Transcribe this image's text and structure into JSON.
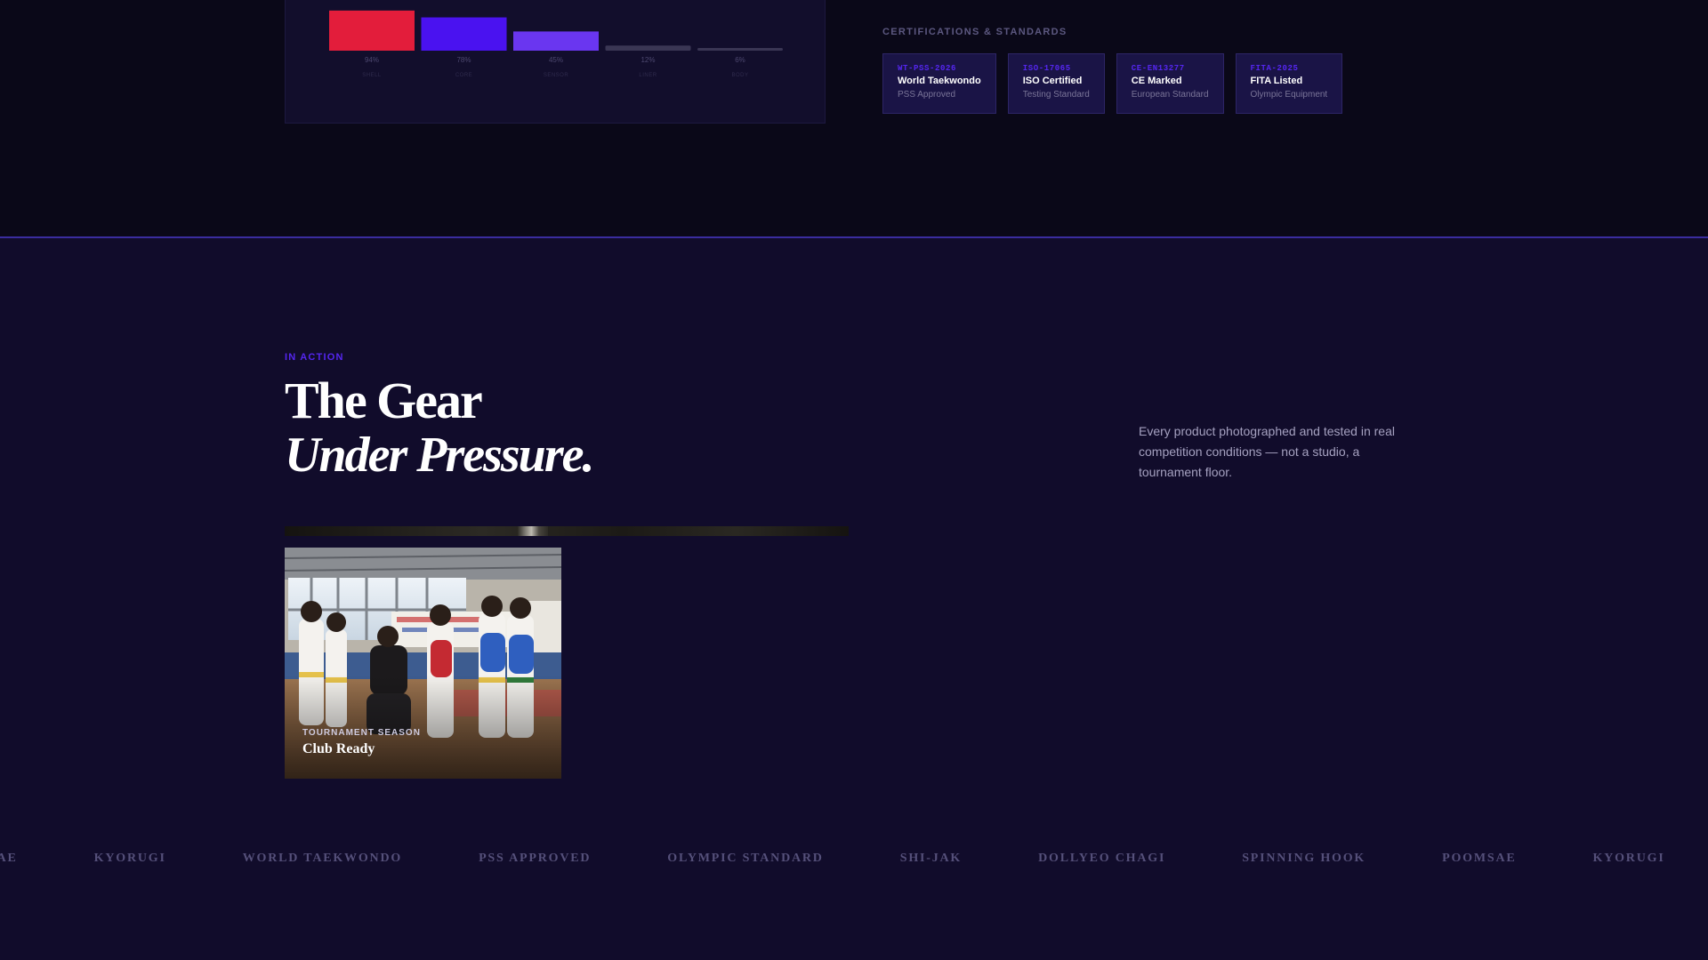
{
  "colors": {
    "bg_top": "#0a0818",
    "bg_bottom": "#110c2b",
    "accent_red": "#e31d3b",
    "accent_violet": "#4a12f0",
    "accent_purple": "#6a36f0",
    "muted_bar": "#3a3654"
  },
  "chart_data": {
    "type": "bar",
    "categories": [
      "SHELL",
      "CORE",
      "SENSOR",
      "LINER",
      "BODY"
    ],
    "values": [
      94,
      78,
      45,
      12,
      6
    ],
    "value_labels": [
      "94%",
      "78%",
      "45%",
      "12%",
      "6%"
    ],
    "colors": [
      "#e31d3b",
      "#4a12f0",
      "#6a36f0",
      "#3a3654",
      "#3a3654"
    ],
    "ylim": [
      0,
      100
    ],
    "grid": false,
    "legend": "none"
  },
  "certifications": {
    "heading": "CERTIFICATIONS & STANDARDS",
    "items": [
      {
        "code": "WT-PSS-2026",
        "title": "World Taekwondo",
        "subtitle": "PSS Approved"
      },
      {
        "code": "ISO-17065",
        "title": "ISO Certified",
        "subtitle": "Testing Standard"
      },
      {
        "code": "CE-EN13277",
        "title": "CE Marked",
        "subtitle": "European Standard"
      },
      {
        "code": "FITA-2025",
        "title": "FITA Listed",
        "subtitle": "Olympic Equipment"
      }
    ]
  },
  "in_action": {
    "eyebrow": "IN ACTION",
    "headline_line1": "The Gear",
    "headline_line2": "Under Pressure.",
    "intro": "Every product photographed and tested in real competition conditions — not a studio, a tournament floor."
  },
  "photo_card": {
    "kicker": "TOURNAMENT SEASON",
    "title": "Club Ready",
    "image_icon": "dojo-photo"
  },
  "marquee": {
    "items": [
      "MSAE",
      "KYORUGI",
      "WORLD TAEKWONDO",
      "PSS APPROVED",
      "OLYMPIC STANDARD",
      "SHI-JAK",
      "DOLLYEO CHAGI",
      "SPINNING HOOK",
      "POOMSAE",
      "KYORUGI"
    ]
  }
}
